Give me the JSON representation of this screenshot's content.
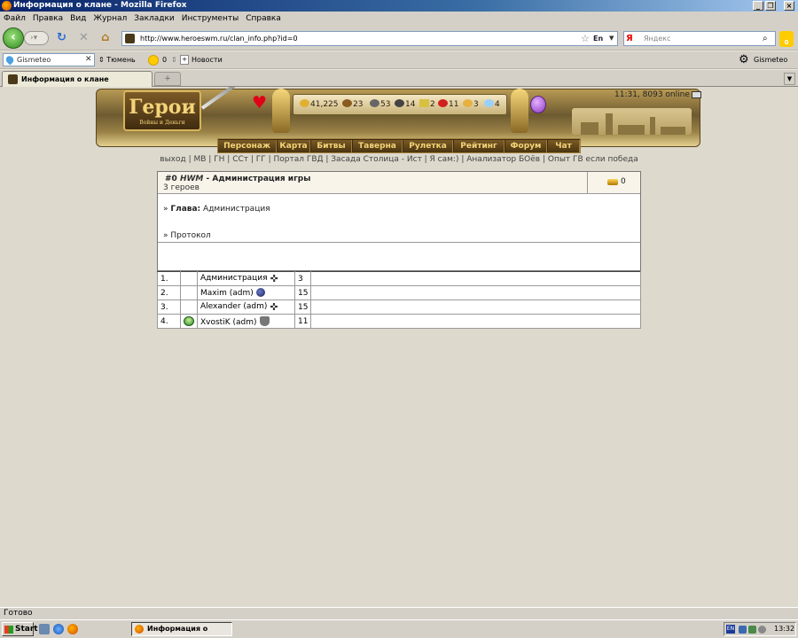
{
  "window": {
    "title": "Информация о клане - Mozilla Firefox"
  },
  "menubar": [
    "Файл",
    "Правка",
    "Вид",
    "Журнал",
    "Закладки",
    "Инструменты",
    "Справка"
  ],
  "nav": {
    "url": "http://www.heroeswm.ru/clan_info.php?id=0",
    "lang": "En",
    "search_placeholder": "Яндекс",
    "search_logo": "Я",
    "badge_count": "0"
  },
  "bookmarks": {
    "gismeteo_input": "Gismeteo",
    "city": "Тюмень",
    "coins": "0",
    "news": "Новости",
    "gismeteo_bar": "Gismeteo Bar"
  },
  "tab": {
    "title": "Информация о клане"
  },
  "game": {
    "logo_title": "Герои",
    "logo_subtitle": "Войны и Деньги",
    "online_text": "11:31, 8093 online",
    "resources": {
      "gold": "41,225",
      "wood": "23",
      "ore": "53",
      "mercury": "14",
      "sulfur": "2",
      "crystals": "11",
      "gems": "3",
      "diamonds": "4"
    },
    "menu": [
      "Персонаж",
      "Карта",
      "Битвы",
      "Таверна",
      "Рулетка",
      "Рейтинг",
      "Форум",
      "Чат"
    ],
    "links": "выход | МВ | ГН | ССт | ГГ | Портал ГВД | Засада Столица - Ист | Я сам:) | Анализатор БОёв | Опыт ГВ если победа"
  },
  "clan": {
    "id_label": "#0",
    "short_name": "HWM",
    "separator": "-",
    "full_name": "Администрация игры",
    "heroes_count": "3 героев",
    "gold": "0",
    "head_label": "Глава:",
    "head_value": "Администрация",
    "protocol": "Протокол",
    "members": [
      {
        "num": "1.",
        "name": "Администрация",
        "level": "3",
        "icon": "cross-icon",
        "avatar": false
      },
      {
        "num": "2.",
        "name": "Maxim (adm)",
        "level": "15",
        "icon": "dark-circle-icon",
        "avatar": false
      },
      {
        "num": "3.",
        "name": "Alexander (adm)",
        "level": "15",
        "icon": "cross-icon",
        "avatar": false
      },
      {
        "num": "4.",
        "name": "XvostiK (adm)",
        "level": "11",
        "icon": "shield-icon",
        "avatar": true
      }
    ]
  },
  "statusbar": "Готово",
  "taskbar": {
    "start": "Start",
    "item": "Информация о клане...",
    "clock": "13:32",
    "lang": "EN"
  }
}
